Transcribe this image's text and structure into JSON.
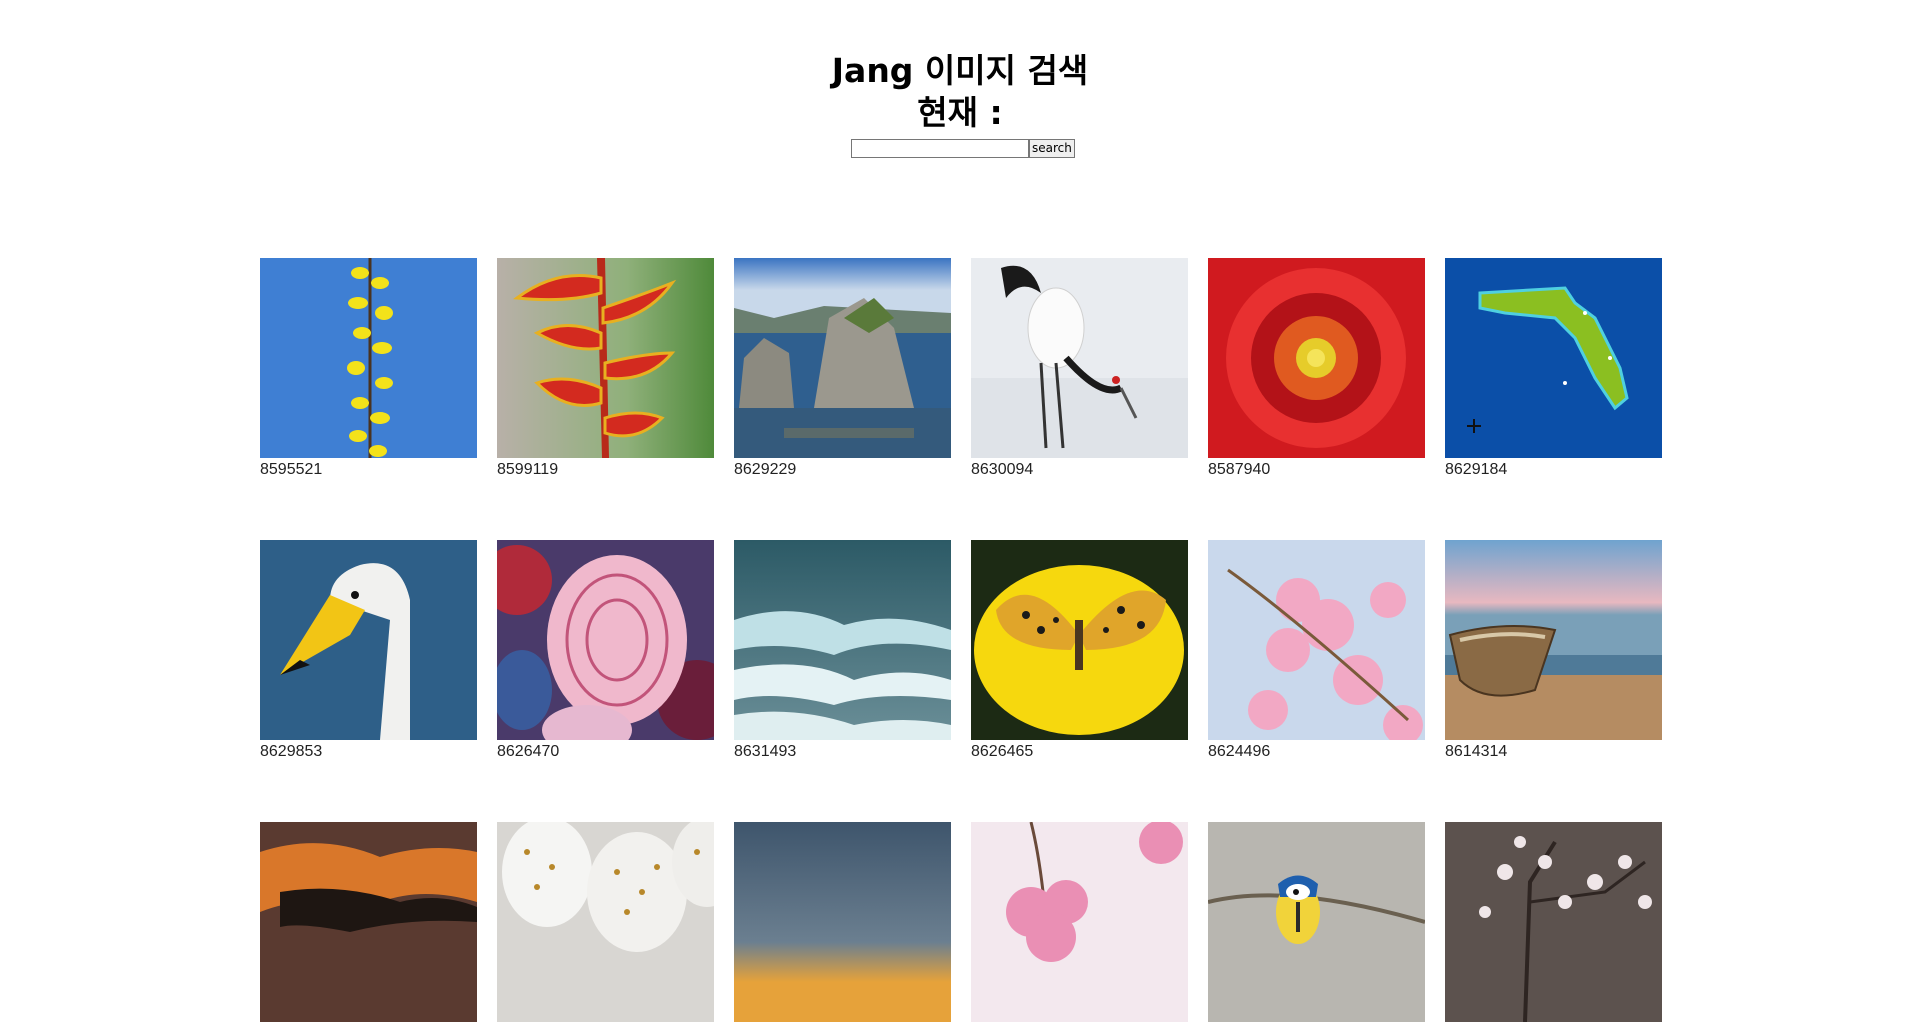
{
  "header": {
    "title_line1": "Jang 이미지 검색",
    "title_line2": "현재 :"
  },
  "search": {
    "value": "",
    "placeholder": "",
    "button_label": "search"
  },
  "gallery": {
    "items": [
      {
        "id": "8595521",
        "subject": "yellow forsythia branch against blue sky"
      },
      {
        "id": "8599119",
        "subject": "red heliconia flower"
      },
      {
        "id": "8629229",
        "subject": "rocky sea stacks coastline"
      },
      {
        "id": "8630094",
        "subject": "red-crowned crane in snow"
      },
      {
        "id": "8587940",
        "subject": "red dahlia"
      },
      {
        "id": "8629184",
        "subject": "Florida illustrated map"
      },
      {
        "id": "8629853",
        "subject": "whooper swan head"
      },
      {
        "id": "8626470",
        "subject": "decorated easter eggs"
      },
      {
        "id": "8631493",
        "subject": "ocean waves"
      },
      {
        "id": "8626465",
        "subject": "fritillary butterfly on yellow flower"
      },
      {
        "id": "8624496",
        "subject": "pink cherry blossoms"
      },
      {
        "id": "8614314",
        "subject": "wooden boat on beach"
      },
      {
        "id": "",
        "subject": "orange sunset clouds"
      },
      {
        "id": "",
        "subject": "white eggs with gold dots"
      },
      {
        "id": "",
        "subject": "dusky sky with sunset glow"
      },
      {
        "id": "",
        "subject": "pink blossom branch"
      },
      {
        "id": "",
        "subject": "blue tit on branch"
      },
      {
        "id": "",
        "subject": "white blossoms on dark branch"
      }
    ]
  }
}
